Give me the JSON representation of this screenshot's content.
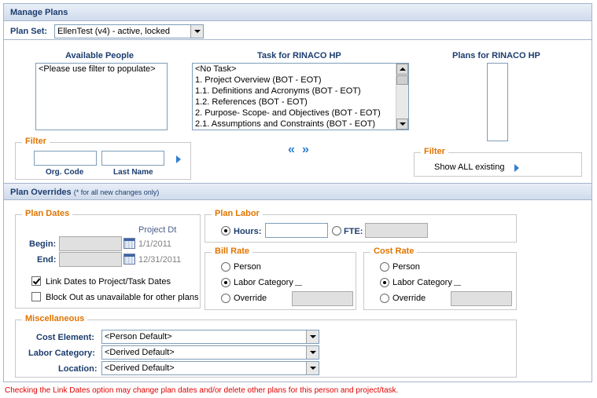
{
  "manage_plans": {
    "title": "Manage Plans",
    "plan_set_label": "Plan Set:",
    "plan_set_value": "EllenTest (v4) - active, locked"
  },
  "available_people": {
    "heading": "Available People",
    "items": [
      "<Please use filter to populate>"
    ]
  },
  "task_list": {
    "heading": "Task for RINACO HP",
    "items": [
      "<No Task>",
      "1. Project Overview (BOT - EOT)",
      "1.1. Definitions and Acronyms (BOT - EOT)",
      "1.2. References (BOT - EOT)",
      "2. Purpose- Scope- and Objectives (BOT - EOT)",
      "2.1. Assumptions and Constraints (BOT - EOT)"
    ]
  },
  "plans_list": {
    "heading": "Plans for RINACO HP",
    "items": []
  },
  "people_filter": {
    "legend": "Filter",
    "org_code_label": "Org. Code",
    "last_name_label": "Last Name",
    "org_code_value": "",
    "last_name_value": ""
  },
  "move_buttons": {
    "left": "«",
    "right": "»"
  },
  "plans_filter": {
    "legend": "Filter",
    "option_label": "Show ALL existing"
  },
  "overrides": {
    "title": "Plan Overrides",
    "note": "(* for all new changes only)"
  },
  "plan_dates": {
    "legend": "Plan Dates",
    "project_dt_label": "Project Dt",
    "begin_label": "Begin:",
    "end_label": "End:",
    "begin_value": "",
    "end_value": "",
    "project_begin": "1/1/2011",
    "project_end": "12/31/2011",
    "link_dates_label": "Link Dates to Project/Task Dates",
    "link_dates_checked": true,
    "block_out_label": "Block Out as unavailable for other plans",
    "block_out_checked": false
  },
  "plan_labor": {
    "legend": "Plan Labor",
    "hours_label": "Hours:",
    "fte_label": "FTE:",
    "hours_value": "",
    "fte_value": "",
    "selected": "hours"
  },
  "bill_rate": {
    "legend": "Bill Rate",
    "person_label": "Person",
    "labor_category_label": "Labor Category",
    "override_label": "Override",
    "selected": "labor_category",
    "override_value": ""
  },
  "cost_rate": {
    "legend": "Cost Rate",
    "person_label": "Person",
    "labor_category_label": "Labor Category",
    "override_label": "Override",
    "selected": "labor_category",
    "override_value": ""
  },
  "miscellaneous": {
    "legend": "Miscellaneous",
    "cost_element_label": "Cost Element:",
    "cost_element_value": "<Person Default>",
    "labor_category_label": "Labor Category:",
    "labor_category_value": "<Derived Default>",
    "location_label": "Location:",
    "location_value": "<Derived Default>"
  },
  "footer_note": "Checking the Link Dates option may change plan dates and/or delete other plans for this person and project/task.",
  "colors": {
    "header_text": "#1c3d6f",
    "legend_orange": "#e07400",
    "warning_red": "#e00000",
    "arrow_blue": "#2f7fd0"
  }
}
